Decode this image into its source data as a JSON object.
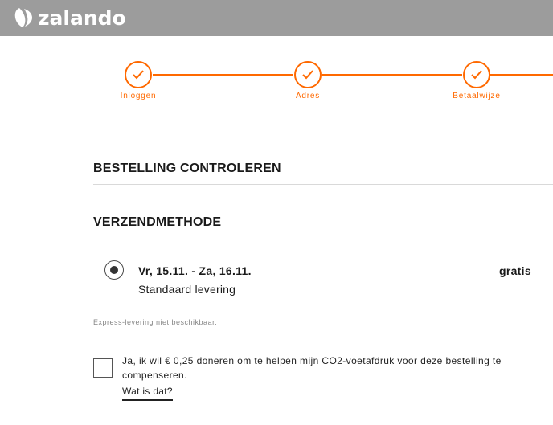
{
  "header": {
    "brand": "zalando"
  },
  "progress": {
    "accent_color": "#ff6900",
    "steps": [
      {
        "label": "Inloggen",
        "icon": "check-icon"
      },
      {
        "label": "Adres",
        "icon": "check-icon"
      },
      {
        "label": "Betaalwijze",
        "icon": "check-icon"
      }
    ]
  },
  "main": {
    "title": "BESTELLING CONTROLEREN",
    "shipping": {
      "title": "VERZENDMETHODE",
      "option": {
        "selected": true,
        "date": "Vr, 15.11. - Za, 16.11.",
        "type": "Standaard levering",
        "price": "gratis"
      },
      "express_note": "Express-levering niet beschikbaar."
    },
    "donation": {
      "checked": false,
      "text": "Ja, ik wil € 0,25 doneren om te helpen mijn CO2-voetafdruk voor deze bestelling te compenseren.",
      "link": "Wat is dat?"
    }
  }
}
